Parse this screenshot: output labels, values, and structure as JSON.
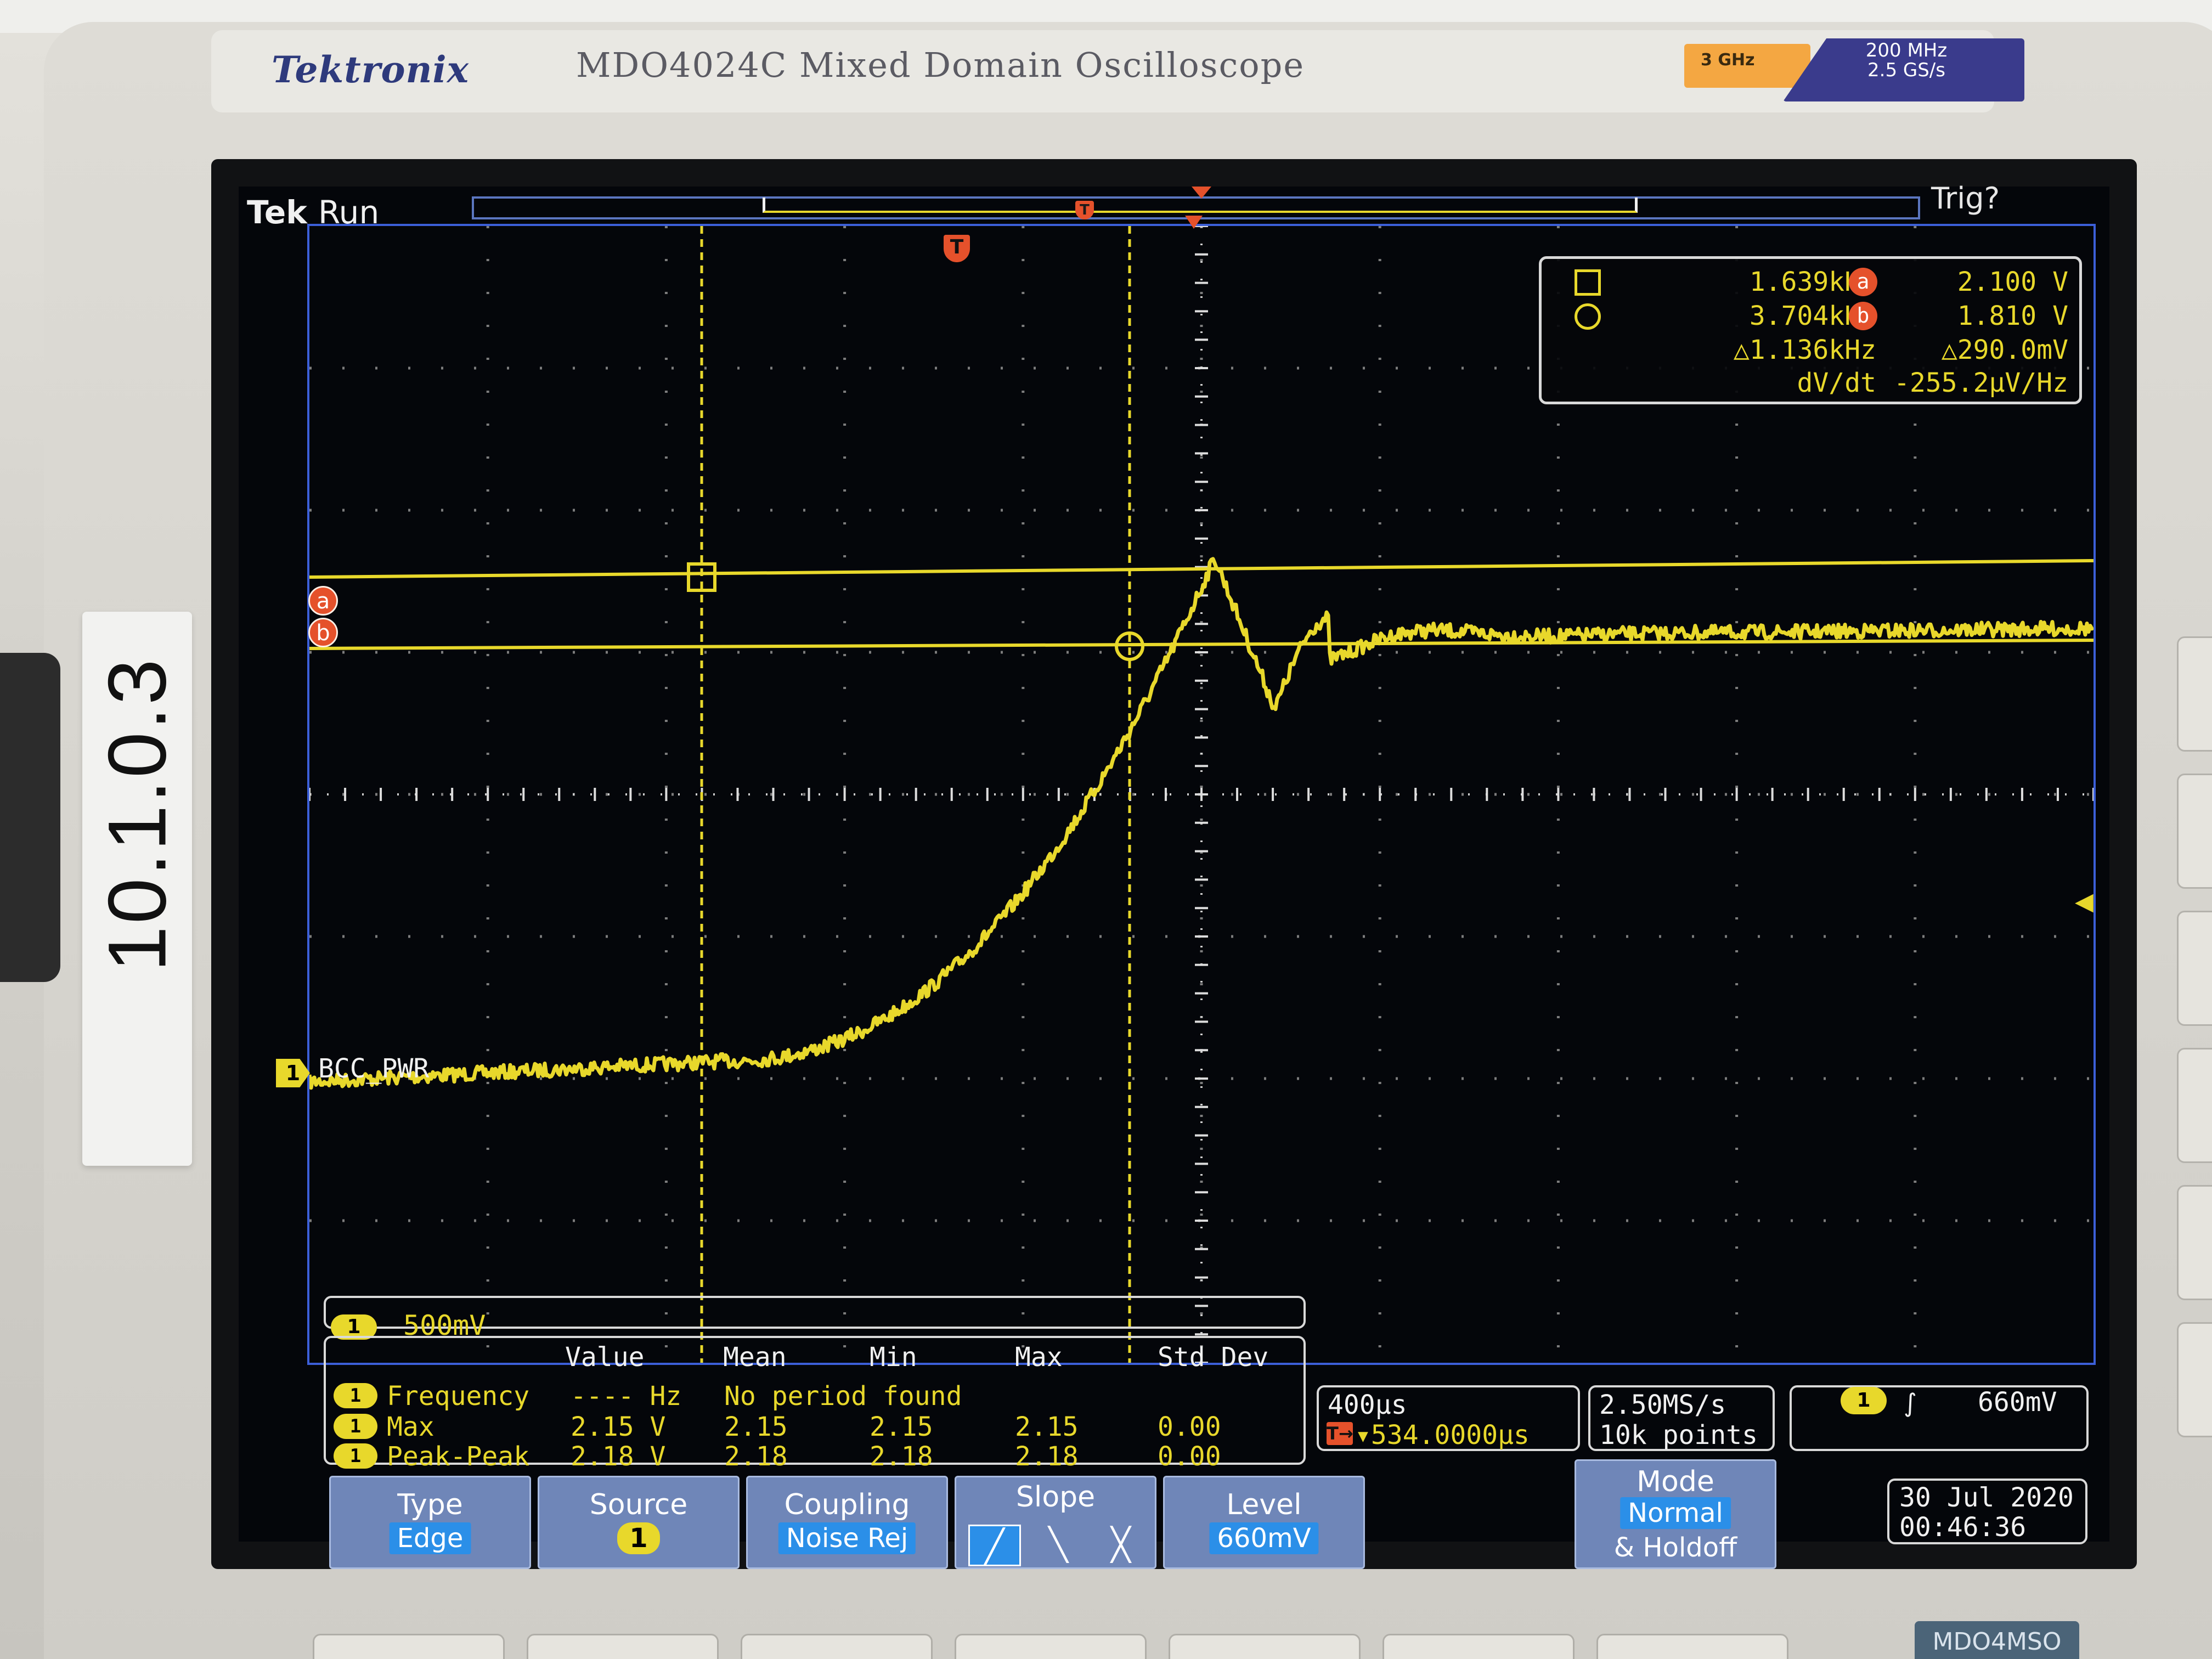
{
  "hardware": {
    "brand": "Tektronix",
    "model": "MDO4024C Mixed Domain Oscilloscope",
    "rf_bandwidth": "3 GHz",
    "bandwidth_line1": "200 MHz",
    "bandwidth_line2": "2.5 GS/s",
    "ip_label": "10.1.0.3",
    "model_tag": "MDO4MSO"
  },
  "status": {
    "tek": "Tek",
    "run": "Run",
    "trigger": "Trig?",
    "timebase_T": "T"
  },
  "channel": {
    "number": "1",
    "name": "BCC_PWR",
    "scale": "500mV"
  },
  "cursors": {
    "tag_a": "a",
    "tag_b": "b",
    "t1": "1.639kHz",
    "t2": "3.704kHz",
    "dt": "△1.136kHz",
    "dvdt_label": "dV/dt",
    "va": "2.100 V",
    "vb": "1.810 V",
    "dv": "△290.0mV",
    "dvdt": "-255.2µV/Hz"
  },
  "measurements": {
    "headers": {
      "value": "Value",
      "mean": "Mean",
      "min": "Min",
      "max": "Max",
      "std": "Std Dev"
    },
    "rows": [
      {
        "badge": "1",
        "name": "Frequency",
        "value": "---- Hz",
        "mean": "No period found",
        "min": "",
        "max": "",
        "std": ""
      },
      {
        "badge": "1",
        "name": "Max",
        "value": "2.15 V",
        "mean": "2.15",
        "min": "2.15",
        "max": "2.15",
        "std": "0.00"
      },
      {
        "badge": "1",
        "name": "Peak-Peak",
        "value": "2.18 V",
        "mean": "2.18",
        "min": "2.18",
        "max": "2.18",
        "std": "0.00"
      }
    ]
  },
  "horizontal": {
    "scale": "400µs",
    "delay": "▾534.0000µs",
    "delay_icon": "T→",
    "sample_rate": "2.50MS/s",
    "record_length": "10k points"
  },
  "trigger": {
    "source": "1",
    "slope_icon": "rising-edge-icon",
    "slope_glyph": "∫",
    "level": "660mV"
  },
  "menu": {
    "type_label": "Type",
    "type_value": "Edge",
    "source_label": "Source",
    "source_value": "1",
    "coupling_label": "Coupling",
    "coupling_value": "Noise Rej",
    "slope_label": "Slope",
    "level_label": "Level",
    "level_value": "660mV",
    "mode_label": "Mode",
    "mode_value": "Normal",
    "mode_sub": "& Holdoff"
  },
  "datetime": {
    "date": "30 Jul  2020",
    "time": "00:46:36"
  },
  "colors": {
    "trace": "#e8d82b",
    "graticule_border": "#3c5fd8",
    "marker_orange": "#e5512b",
    "menu_button": "#6f86b8",
    "menu_value": "#2b8fe8"
  }
}
